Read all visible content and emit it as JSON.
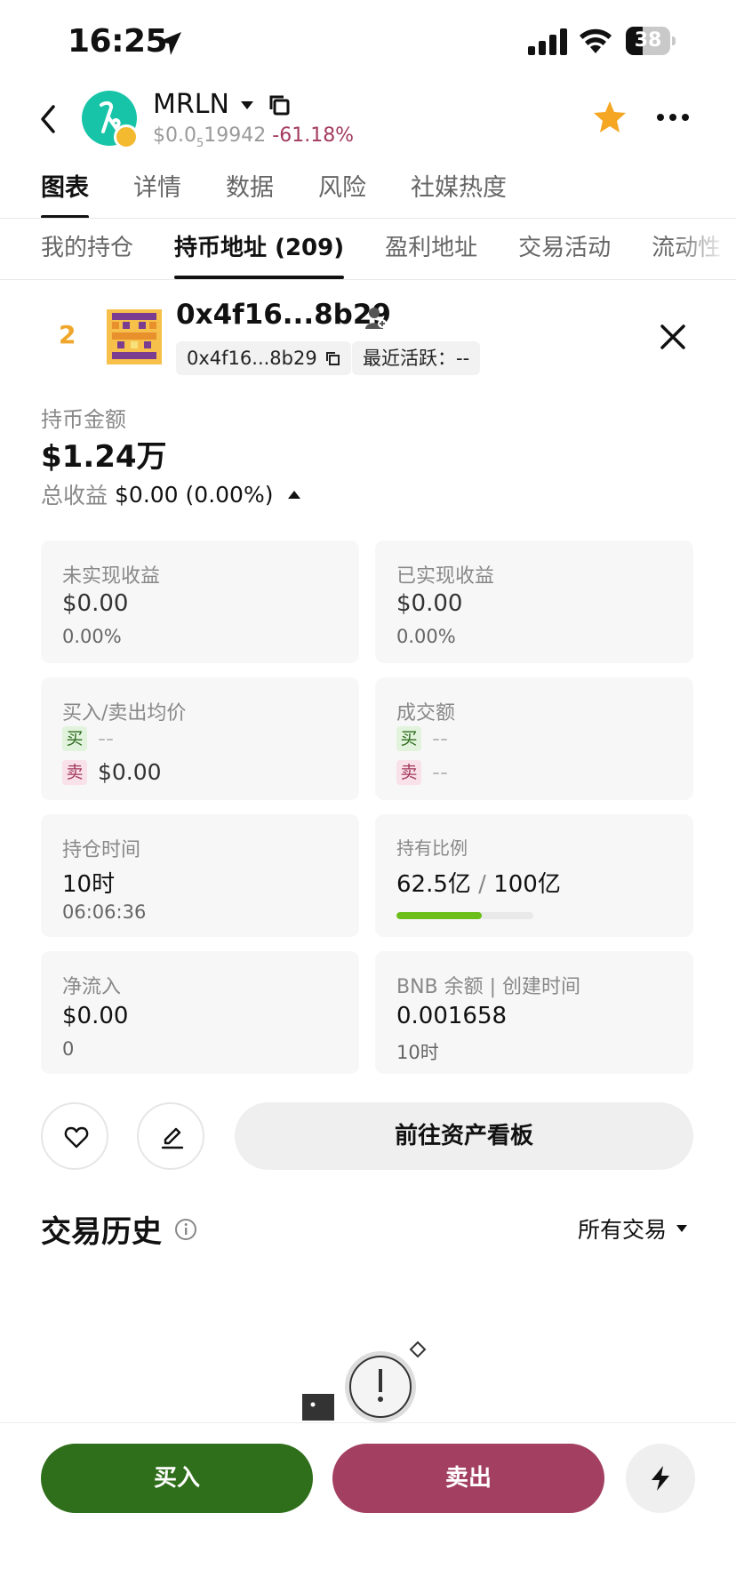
{
  "status_bar": {
    "time": "16:25",
    "battery": "38",
    "battery_level": 0.38
  },
  "header": {
    "token_name": "MRLN",
    "price_prefix": "$0.0",
    "price_subscript": "5",
    "price_digits": "19942",
    "price_change": "-61.18%",
    "accent_color": "#a33a5f",
    "favorite_color": "#f5a623"
  },
  "main_tabs": [
    {
      "label": "图表",
      "active": true
    },
    {
      "label": "详情"
    },
    {
      "label": "数据"
    },
    {
      "label": "风险"
    },
    {
      "label": "社媒热度"
    }
  ],
  "sub_tabs": [
    {
      "label": "我的持仓"
    },
    {
      "label": "持币地址 (209)",
      "active": true
    },
    {
      "label": "盈利地址"
    },
    {
      "label": "交易活动"
    },
    {
      "label": "流动性"
    }
  ],
  "address": {
    "rank": "2",
    "title": "0x4f16...8b29",
    "short": "0x4f16...8b29",
    "last_active": "最近活跃：--"
  },
  "holdings": {
    "label": "持币金额",
    "value": "$1.24万",
    "pnl_label": "总收益",
    "pnl_value": "$0.00 (0.00%)"
  },
  "cards": {
    "unrealized": {
      "label": "未实现收益",
      "value": "$0.00",
      "pct": "0.00%"
    },
    "realized": {
      "label": "已实现收益",
      "value": "$0.00",
      "pct": "0.00%"
    },
    "avg_price": {
      "label": "买入/卖出均价",
      "buy_tag": "买",
      "buy_value": "--",
      "sell_tag": "卖",
      "sell_value": "$0.00"
    },
    "volume": {
      "label": "成交额",
      "buy_tag": "买",
      "buy_value": "--",
      "sell_tag": "卖",
      "sell_value": "--"
    },
    "hold_time": {
      "label": "持仓时间",
      "value": "10时",
      "sub": "06:06:36"
    },
    "hold_ratio": {
      "label": "持有比例",
      "held": "62.5亿",
      "sep": "/",
      "total": "100亿",
      "ratio": 0.625,
      "bar_color": "#6cbf1a"
    },
    "net_inflow": {
      "label": "净流入",
      "value": "$0.00",
      "sub": "0"
    },
    "bnb": {
      "label": "BNB 余额 | 创建时间",
      "value": "0.001658",
      "sub": "10时"
    }
  },
  "actions": {
    "dashboard_label": "前往资产看板"
  },
  "history": {
    "title": "交易历史",
    "filter": "所有交易"
  },
  "bottom": {
    "buy": "买入",
    "sell": "卖出",
    "buy_color": "#2f6e1a",
    "sell_color": "#a33f60"
  },
  "icons": [
    "location-arrow-icon",
    "signal-icon",
    "wifi-icon",
    "back-icon",
    "copy-icon",
    "star-icon",
    "more-icon",
    "person-icon",
    "close-icon",
    "heart-icon",
    "edit-icon",
    "info-icon",
    "lightning-icon"
  ]
}
